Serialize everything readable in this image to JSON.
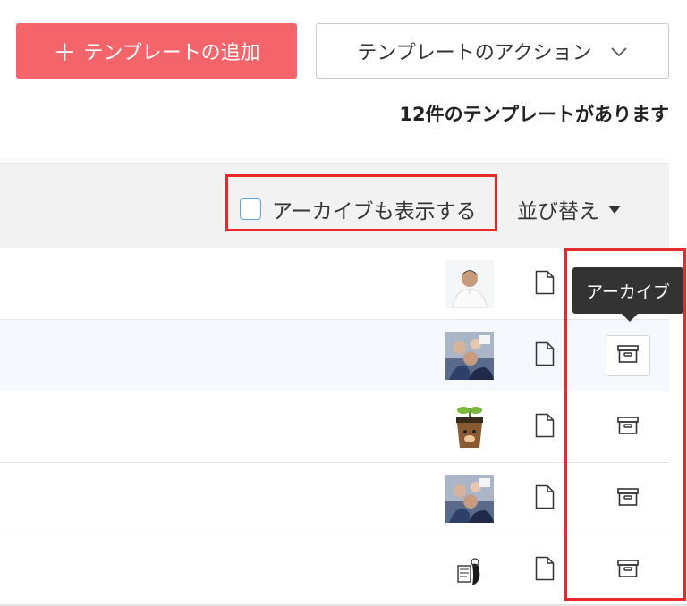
{
  "header": {
    "add_button": {
      "icon": "plus-icon",
      "label": "テンプレートの追加"
    },
    "action_button": {
      "label": "テンプレートのアクション",
      "icon": "chevron-down-icon"
    },
    "count_text": "12件のテンプレートがあります"
  },
  "toolbar": {
    "show_archived_label": "アーカイブも表示する",
    "show_archived_checked": false,
    "sort_label": "並び替え"
  },
  "tooltip": {
    "label": "アーカイブ"
  },
  "rows": [
    {
      "avatar": "person-photo-avatar",
      "doc_icon": "document-icon",
      "archive_icon": "archive-box-icon"
    },
    {
      "avatar": "group-photo-avatar",
      "doc_icon": "document-icon",
      "archive_icon": "archive-box-icon",
      "hovered": true
    },
    {
      "avatar": "sprout-pot-avatar",
      "doc_icon": "document-icon",
      "archive_icon": "archive-box-icon"
    },
    {
      "avatar": "group-photo-avatar",
      "doc_icon": "document-icon",
      "archive_icon": "archive-box-icon"
    },
    {
      "avatar": "sketch-avatar",
      "doc_icon": "document-icon",
      "archive_icon": "archive-box-icon"
    }
  ],
  "colors": {
    "primary": "#f4656b",
    "highlight": "#e52a2a",
    "checkbox_border": "#5aa6e6",
    "tooltip_bg": "#333333"
  }
}
